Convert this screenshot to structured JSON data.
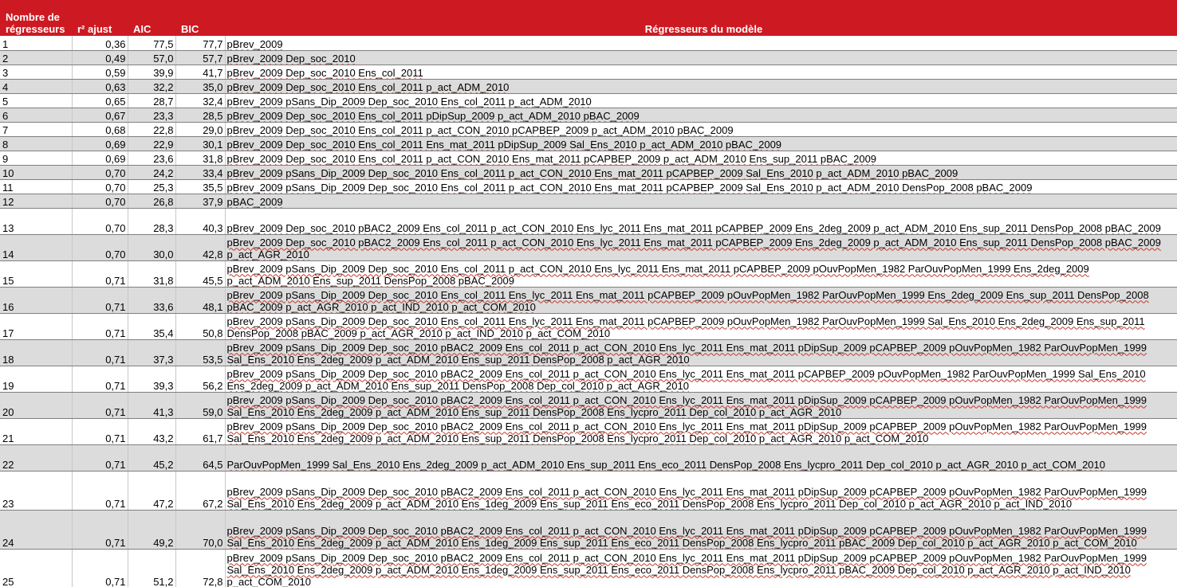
{
  "header": {
    "col_n": "Nombre de régresseurs",
    "col_r2": "r² ajust",
    "col_aic": "AIC",
    "col_bic": "BIC",
    "col_reg": "Régresseurs du modèle"
  },
  "rows": [
    {
      "n": "1",
      "r2": "0,36",
      "aic": "77,5",
      "bic": "77,7",
      "reg": "pBrev_2009"
    },
    {
      "n": "2",
      "r2": "0,49",
      "aic": "57,0",
      "bic": "57,7",
      "reg": "pBrev_2009 Dep_soc_2010"
    },
    {
      "n": "3",
      "r2": "0,59",
      "aic": "39,9",
      "bic": "41,7",
      "reg": "pBrev_2009 Dep_soc_2010 Ens_col_2011"
    },
    {
      "n": "4",
      "r2": "0,63",
      "aic": "32,2",
      "bic": "35,0",
      "reg": "pBrev_2009 Dep_soc_2010 Ens_col_2011 p_act_ADM_2010"
    },
    {
      "n": "5",
      "r2": "0,65",
      "aic": "28,7",
      "bic": "32,4",
      "reg": "pBrev_2009 pSans_Dip_2009 Dep_soc_2010 Ens_col_2011 p_act_ADM_2010"
    },
    {
      "n": "6",
      "r2": "0,67",
      "aic": "23,3",
      "bic": "28,5",
      "reg": "pBrev_2009 Dep_soc_2010 Ens_col_2011 pDipSup_2009 p_act_ADM_2010 pBAC_2009"
    },
    {
      "n": "7",
      "r2": "0,68",
      "aic": "22,8",
      "bic": "29,0",
      "reg": "pBrev_2009 Dep_soc_2010 Ens_col_2011 p_act_CON_2010 pCAPBEP_2009 p_act_ADM_2010 pBAC_2009"
    },
    {
      "n": "8",
      "r2": "0,69",
      "aic": "22,9",
      "bic": "30,1",
      "reg": "pBrev_2009 Dep_soc_2010 Ens_col_2011 Ens_mat_2011 pDipSup_2009 Sal_Ens_2010 p_act_ADM_2010 pBAC_2009"
    },
    {
      "n": "9",
      "r2": "0,69",
      "aic": "23,6",
      "bic": "31,8",
      "reg": "pBrev_2009 Dep_soc_2010 Ens_col_2011 p_act_CON_2010 Ens_mat_2011 pCAPBEP_2009 p_act_ADM_2010 Ens_sup_2011 pBAC_2009"
    },
    {
      "n": "10",
      "r2": "0,70",
      "aic": "24,2",
      "bic": "33,4",
      "reg": "pBrev_2009 pSans_Dip_2009 Dep_soc_2010 Ens_col_2011 p_act_CON_2010 Ens_mat_2011 pCAPBEP_2009 Sal_Ens_2010 p_act_ADM_2010 pBAC_2009"
    },
    {
      "n": "11",
      "r2": "0,70",
      "aic": "25,3",
      "bic": "35,5",
      "reg": "pBrev_2009 pSans_Dip_2009 Dep_soc_2010 Ens_col_2011 p_act_CON_2010 Ens_mat_2011 pCAPBEP_2009 Sal_Ens_2010 p_act_ADM_2010 DensPop_2008 pBAC_2009"
    },
    {
      "n": "12",
      "r2": "0,70",
      "aic": "26,8",
      "bic": "37,9",
      "reg": "pBAC_2009"
    },
    {
      "n": "13",
      "r2": "0,70",
      "aic": "28,3",
      "bic": "40,3",
      "reg": "pBrev_2009 Dep_soc_2010 pBAC2_2009 Ens_col_2011 p_act_CON_2010 Ens_lyc_2011 Ens_mat_2011 pCAPBEP_2009 Ens_2deg_2009 p_act_ADM_2010 Ens_sup_2011 DensPop_2008 pBAC_2009"
    },
    {
      "n": "14",
      "r2": "0,70",
      "aic": "30,0",
      "bic": "42,8",
      "reg": "pBrev_2009 Dep_soc_2010 pBAC2_2009 Ens_col_2011 p_act_CON_2010 Ens_lyc_2011 Ens_mat_2011 pCAPBEP_2009 Ens_2deg_2009 p_act_ADM_2010 Ens_sup_2011 DensPop_2008 pBAC_2009 p_act_AGR_2010"
    },
    {
      "n": "15",
      "r2": "0,71",
      "aic": "31,8",
      "bic": "45,5",
      "reg": "pBrev_2009 pSans_Dip_2009 Dep_soc_2010 Ens_col_2011 p_act_CON_2010 Ens_lyc_2011 Ens_mat_2011 pCAPBEP_2009 pOuvPopMen_1982 ParOuvPopMen_1999 Ens_2deg_2009 p_act_ADM_2010 Ens_sup_2011 DensPop_2008 pBAC_2009"
    },
    {
      "n": "16",
      "r2": "0,71",
      "aic": "33,6",
      "bic": "48,1",
      "reg": "pBrev_2009 pSans_Dip_2009 Dep_soc_2010 Ens_col_2011 Ens_lyc_2011 Ens_mat_2011 pCAPBEP_2009 pOuvPopMen_1982 ParOuvPopMen_1999 Ens_2deg_2009 Ens_sup_2011 DensPop_2008 pBAC_2009 p_act_AGR_2010 p_act_IND_2010 p_act_COM_2010"
    },
    {
      "n": "17",
      "r2": "0,71",
      "aic": "35,4",
      "bic": "50,8",
      "reg": "pBrev_2009 pSans_Dip_2009 Dep_soc_2010 Ens_col_2011 Ens_lyc_2011 Ens_mat_2011 pCAPBEP_2009 pOuvPopMen_1982 ParOuvPopMen_1999 Sal_Ens_2010 Ens_2deg_2009 Ens_sup_2011 DensPop_2008 pBAC_2009 p_act_AGR_2010 p_act_IND_2010 p_act_COM_2010"
    },
    {
      "n": "18",
      "r2": "0,71",
      "aic": "37,3",
      "bic": "53,5",
      "reg": "pBrev_2009 pSans_Dip_2009 Dep_soc_2010 pBAC2_2009 Ens_col_2011 p_act_CON_2010 Ens_lyc_2011 Ens_mat_2011 pDipSup_2009 pCAPBEP_2009 pOuvPopMen_1982 ParOuvPopMen_1999 Sal_Ens_2010 Ens_2deg_2009 p_act_ADM_2010 Ens_sup_2011 DensPop_2008 p_act_AGR_2010"
    },
    {
      "n": "19",
      "r2": "0,71",
      "aic": "39,3",
      "bic": "56,2",
      "reg": "pBrev_2009 pSans_Dip_2009 Dep_soc_2010 pBAC2_2009 Ens_col_2011 p_act_CON_2010 Ens_lyc_2011 Ens_mat_2011 pCAPBEP_2009 pOuvPopMen_1982 ParOuvPopMen_1999 Sal_Ens_2010 Ens_2deg_2009 p_act_ADM_2010 Ens_sup_2011 DensPop_2008 Dep_col_2010 p_act_AGR_2010"
    },
    {
      "n": "20",
      "r2": "0,71",
      "aic": "41,3",
      "bic": "59,0",
      "reg": "pBrev_2009 pSans_Dip_2009 Dep_soc_2010 pBAC2_2009 Ens_col_2011 p_act_CON_2010 Ens_lyc_2011 Ens_mat_2011 pDipSup_2009 pCAPBEP_2009 pOuvPopMen_1982 ParOuvPopMen_1999 Sal_Ens_2010 Ens_2deg_2009 p_act_ADM_2010 Ens_sup_2011 DensPop_2008 Ens_lycpro_2011 Dep_col_2010 p_act_AGR_2010"
    },
    {
      "n": "21",
      "r2": "0,71",
      "aic": "43,2",
      "bic": "61,7",
      "reg": "pBrev_2009 pSans_Dip_2009 Dep_soc_2010 pBAC2_2009 Ens_col_2011 p_act_CON_2010 Ens_lyc_2011 Ens_mat_2011 pDipSup_2009 pCAPBEP_2009 pOuvPopMen_1982 ParOuvPopMen_1999 Sal_Ens_2010 Ens_2deg_2009 p_act_ADM_2010 Ens_sup_2011 DensPop_2008 Ens_lycpro_2011 Dep_col_2010 p_act_AGR_2010 p_act_COM_2010"
    },
    {
      "n": "22",
      "r2": "0,71",
      "aic": "45,2",
      "bic": "64,5",
      "reg": "ParOuvPopMen_1999 Sal_Ens_2010 Ens_2deg_2009 p_act_ADM_2010 Ens_sup_2011 Ens_eco_2011 DensPop_2008 Ens_lycpro_2011 Dep_col_2010 p_act_AGR_2010 p_act_COM_2010"
    },
    {
      "n": "23",
      "r2": "0,71",
      "aic": "47,2",
      "bic": "67,2",
      "reg": "pBrev_2009 pSans_Dip_2009 Dep_soc_2010 pBAC2_2009 Ens_col_2011 p_act_CON_2010 Ens_lyc_2011 Ens_mat_2011 pDipSup_2009 pCAPBEP_2009 pOuvPopMen_1982 ParOuvPopMen_1999 Sal_Ens_2010 Ens_2deg_2009 p_act_ADM_2010 Ens_1deg_2009 Ens_sup_2011 Ens_eco_2011 DensPop_2008 Ens_lycpro_2011 Dep_col_2010 p_act_AGR_2010 p_act_IND_2010"
    },
    {
      "n": "24",
      "r2": "0,71",
      "aic": "49,2",
      "bic": "70,0",
      "reg": "pBrev_2009 pSans_Dip_2009 Dep_soc_2010 pBAC2_2009 Ens_col_2011 p_act_CON_2010 Ens_lyc_2011 Ens_mat_2011 pDipSup_2009 pCAPBEP_2009 pOuvPopMen_1982 ParOuvPopMen_1999 Sal_Ens_2010 Ens_2deg_2009 p_act_ADM_2010 Ens_1deg_2009 Ens_sup_2011 Ens_eco_2011 DensPop_2008 Ens_lycpro_2011 pBAC_2009 Dep_col_2010 p_act_AGR_2010 p_act_COM_2010"
    },
    {
      "n": "25",
      "r2": "0,71",
      "aic": "51,2",
      "bic": "72,8",
      "reg": "pBrev_2009 pSans_Dip_2009 Dep_soc_2010 pBAC2_2009 Ens_col_2011 p_act_CON_2010 Ens_lyc_2011 Ens_mat_2011 pDipSup_2009 pCAPBEP_2009 pOuvPopMen_1982 ParOuvPopMen_1999 Sal_Ens_2010 Ens_2deg_2009 p_act_ADM_2010 Ens_1deg_2009 Ens_sup_2011 Ens_eco_2011 DensPop_2008 Ens_lycpro_2011 pBAC_2009 Dep_col_2010 p_act_AGR_2010 p_act_IND_2010 p_act_COM_2010"
    }
  ]
}
